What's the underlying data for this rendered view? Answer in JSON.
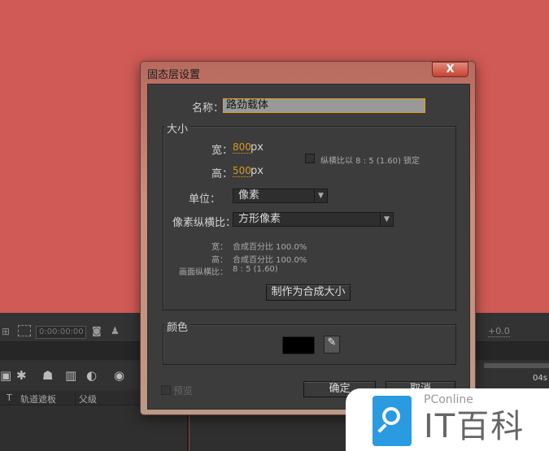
{
  "background_app": {
    "timecode": "0:00:00:00",
    "offset": "+0.0",
    "time_marker": "04s",
    "columns": [
      "T",
      "轨道遮板",
      "父级"
    ]
  },
  "dialog": {
    "title": "固态层设置",
    "close_label": "X",
    "name_label": "名称：",
    "name_value": "路劲载体",
    "size_group": "大小",
    "width_label": "宽：",
    "width_value": "800",
    "height_label": "高：",
    "height_value": "500",
    "unit_px": "px",
    "lock_label": "纵横比以 8 : 5 (1.60) 锁定",
    "lock_checked": false,
    "units_label": "单位：",
    "units_value": "像素",
    "par_label": "像素纵横比：",
    "par_value": "方形像素",
    "info_w_label": "宽：",
    "info_w_value": "合成百分比 100.0%",
    "info_h_label": "高：",
    "info_h_value": "合成百分比 100.0%",
    "info_ar_label": "画面纵横比：",
    "info_ar_value": "8 : 5 (1.60)",
    "make_comp_size": "制作为合成大小",
    "color_group": "颜色",
    "color_value": "#000000",
    "preview_label": "预览",
    "ok": "确定",
    "cancel": "取消"
  },
  "watermark": {
    "brand": "PConline",
    "name": "IT百科"
  }
}
